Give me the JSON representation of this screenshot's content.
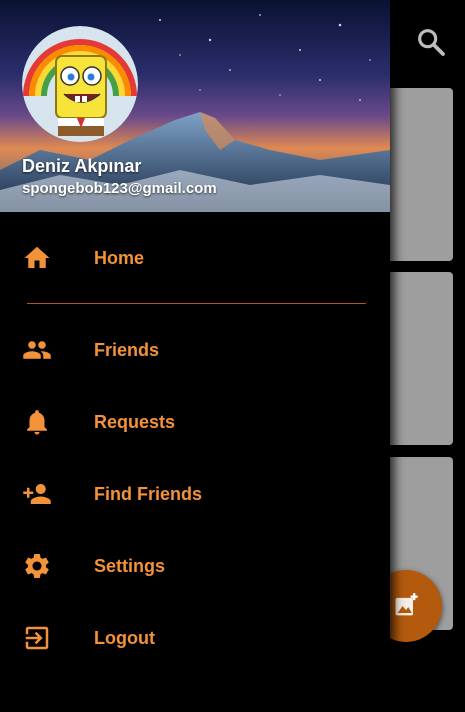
{
  "app": {
    "search_icon": "search-icon",
    "fab_icon": "add-photo-icon"
  },
  "drawer": {
    "user": {
      "name": "Deniz Akpınar",
      "email": "spongebob123@gmail.com"
    },
    "items": [
      {
        "label": "Home",
        "icon": "home-icon"
      },
      {
        "label": "Friends",
        "icon": "people-icon"
      },
      {
        "label": "Requests",
        "icon": "bell-icon"
      },
      {
        "label": "Find Friends",
        "icon": "person-add-icon"
      },
      {
        "label": "Settings",
        "icon": "gear-icon"
      },
      {
        "label": "Logout",
        "icon": "logout-icon"
      }
    ]
  },
  "colors": {
    "accent": "#f4923a",
    "card": "#9e9e9e",
    "fab": "#b35a0f",
    "background": "#000000"
  }
}
